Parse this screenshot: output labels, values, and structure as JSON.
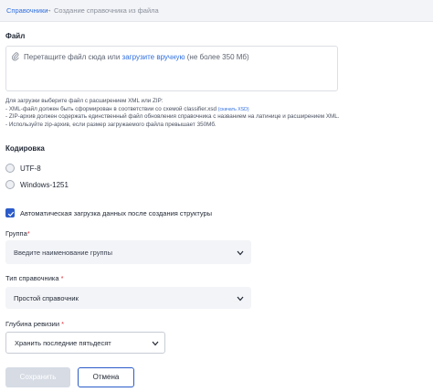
{
  "breadcrumb": {
    "parent": "Справочники",
    "separator": "→",
    "current": "Создание справочника из файла"
  },
  "file_section": {
    "title": "Файл",
    "drop_text": "Перетащите файл сюда или",
    "upload_link": "загрузите вручную",
    "size_note": "(не более 350 Мб)",
    "icon": "paperclip-icon"
  },
  "help": {
    "intro": "Для загрузки выберите файл с расширением XML или ZIP:",
    "line1": "- XML-файл должен быть сформирован в соответствии со схемой classifier.xsd",
    "line1_link": "(скачать XSD)",
    "line2": "- ZIP-архив должен содержать единственный файл обновления справочника с названием на латинице и расширением XML.",
    "line3": "- Используйте zip-архив, если размер загружаемого файла превышает 350Мб."
  },
  "encoding": {
    "title": "Кодировка",
    "options": [
      "UTF-8",
      "Windows-1251"
    ]
  },
  "auto_load": {
    "label": "Автоматическая загрузка данных после создания структуры",
    "checked": true
  },
  "group": {
    "label": "Группа",
    "required_mark": "*",
    "placeholder": "Введите наименование группы"
  },
  "directory_type": {
    "label": "Тип справочника",
    "required_mark": "*",
    "value": "Простой справочник"
  },
  "revision_depth": {
    "label": "Глубина ревизии",
    "required_mark": "*",
    "value": "Хранить последние пятьдесят"
  },
  "actions": {
    "save": "Сохранить",
    "cancel": "Отмена"
  },
  "colors": {
    "accent": "#2b5bc9",
    "link": "#2f6fe0",
    "required": "#e0323a",
    "disabled_button": "#d6dbe4"
  }
}
